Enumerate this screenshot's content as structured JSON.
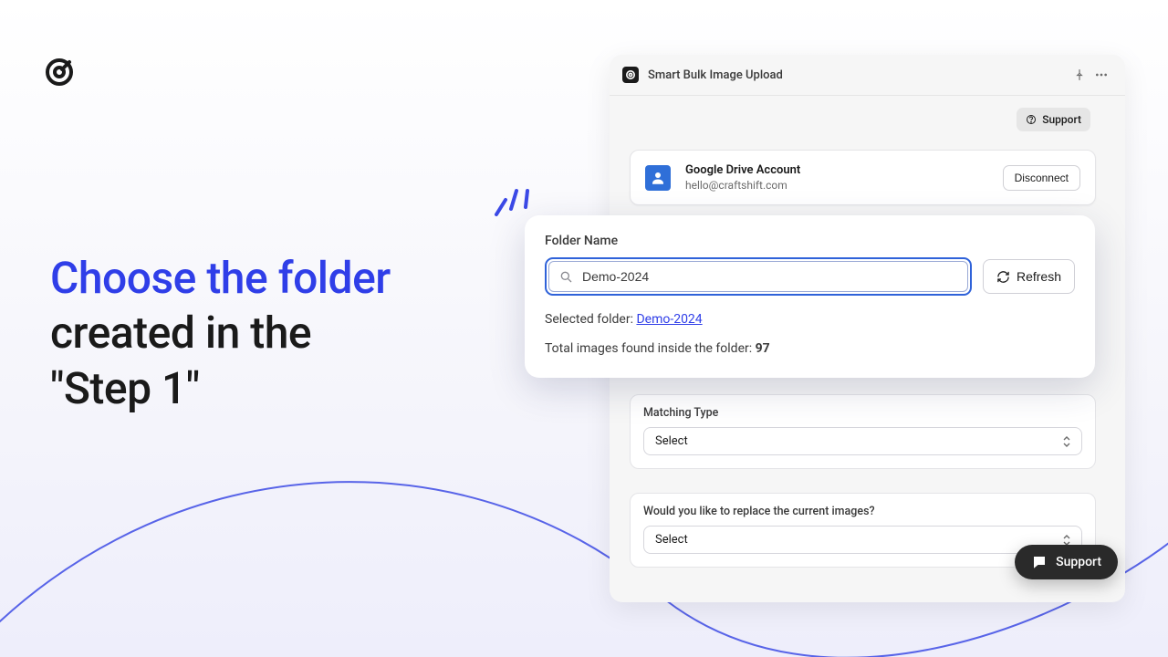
{
  "headline": {
    "accent": "Choose the folder",
    "rest1": "created in the",
    "rest2": "\"Step 1\""
  },
  "app": {
    "title": "Smart Bulk Image Upload",
    "support_pill": "Support",
    "floating_support": "Support"
  },
  "account": {
    "title": "Google Drive Account",
    "email": "hello@craftshift.com",
    "disconnect": "Disconnect"
  },
  "folder": {
    "label": "Folder Name",
    "value": "Demo-2024",
    "refresh": "Refresh",
    "selected_prefix": "Selected folder: ",
    "selected_link": "Demo-2024",
    "total_prefix": "Total images found inside the folder: ",
    "total_count": "97"
  },
  "matching": {
    "label": "Matching Type",
    "select": "Select"
  },
  "replace": {
    "label": "Would you like to replace the current images?",
    "select": "Select"
  }
}
